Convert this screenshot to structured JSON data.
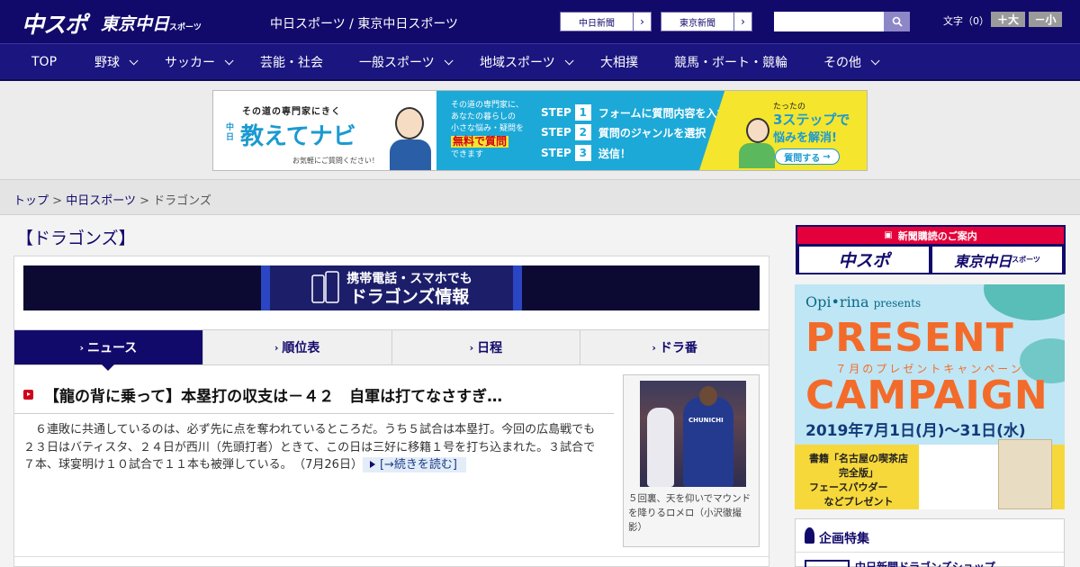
{
  "header": {
    "logo_chuspo": "中スポ",
    "logo_tokyo": "東京中日",
    "logo_tokyo_sub": "スポーツ",
    "site_name": "中日スポーツ / 東京中日スポーツ",
    "link_chunichi": "中日新聞",
    "link_tokyo": "東京新聞",
    "search_placeholder": "",
    "font_size_label": "文字（0）",
    "font_plus": "＋大",
    "font_minus": "－小"
  },
  "nav": {
    "items": [
      {
        "label": "TOP",
        "dropdown": false
      },
      {
        "label": "野球",
        "dropdown": true
      },
      {
        "label": "サッカー",
        "dropdown": true
      },
      {
        "label": "芸能・社会",
        "dropdown": false
      },
      {
        "label": "一般スポーツ",
        "dropdown": true
      },
      {
        "label": "地域スポーツ",
        "dropdown": true
      },
      {
        "label": "大相撲",
        "dropdown": false
      },
      {
        "label": "競馬・ボート・競輪",
        "dropdown": false
      },
      {
        "label": "その他",
        "dropdown": true
      }
    ]
  },
  "ad_top": {
    "tagline": "その道の専門家にきく",
    "brand_small": "中日",
    "brand": "教えてナビ",
    "note": "お気軽にご質問ください！",
    "desc1": "その道の専門家に、",
    "desc2": "あなたの暮らしの",
    "desc3": "小さな悩み・疑問を",
    "desc_highlight": "無料で質問",
    "desc4": "できます",
    "step_word": "STEP",
    "step1_num": "1",
    "step1": "フォームに質問内容を入力",
    "step2_num": "2",
    "step2": "質問のジャンルを選択",
    "step3_num": "3",
    "step3": "送信！",
    "right1": "たったの",
    "right2": "3ステップで",
    "right3": "悩みを解消!",
    "cta": "質問する"
  },
  "breadcrumb": {
    "top": "トップ",
    "sep": ">",
    "mid": "中日スポーツ",
    "current": "ドラゴンズ"
  },
  "page": {
    "title": "【ドラゴンズ】"
  },
  "mobile_banner": {
    "line1": "携帯電話・スマホでも",
    "line2": "ドラゴンズ情報"
  },
  "tabs": [
    {
      "label": "ニュース",
      "active": true
    },
    {
      "label": "順位表",
      "active": false
    },
    {
      "label": "日程",
      "active": false
    },
    {
      "label": "ドラ番",
      "active": false
    }
  ],
  "article": {
    "headline": "【龍の背に乗って】本塁打の収支は－４２　自軍は打てなさすぎ…",
    "body": "６連敗に共通しているのは、必ず先に点を奪われているところだ。うち５試合は本塁打。今回の広島戦でも２３日はバティスタ、２４日が西川（先頭打者）ときて、この日は三好に移籍１号を打ち込まれた。３試合で７本、球宴明け１０試合で１１本も被弾している。",
    "date": "（7月26日）",
    "read_more": "[→続きを読む]",
    "photo_jersey": "CHUNICHI",
    "photo_caption": "５回裏、天を仰いでマウンドを降りるロメロ（小沢徹撮影）"
  },
  "sidebar": {
    "subscription_header": "新聞購読のご案内",
    "sub_chuspo": "中スポ",
    "sub_tokyo": "東京中日",
    "sub_tokyo_small": "スポーツ",
    "campaign_brand": "Opi•rina",
    "campaign_presents": "presents",
    "campaign_big1": "PRESENT",
    "campaign_sub": "７月のプレゼントキャンペーン",
    "campaign_big2": "CAMPAIGN",
    "campaign_date": "2019年7月1日(月)〜31日(水)",
    "campaign_note1": "書籍「名古屋の喫茶店",
    "campaign_note2": "完全版」",
    "campaign_note3": "フェースパウダー",
    "campaign_note4": "などプレゼント",
    "feature_title": "企画特集",
    "feature_item": "中日新聞ドラゴンズショップ"
  },
  "colors": {
    "brand_navy": "#120a6b",
    "nav_blue": "#1b1580",
    "accent_red": "#e4003a",
    "campaign_orange": "#f36b2a"
  }
}
